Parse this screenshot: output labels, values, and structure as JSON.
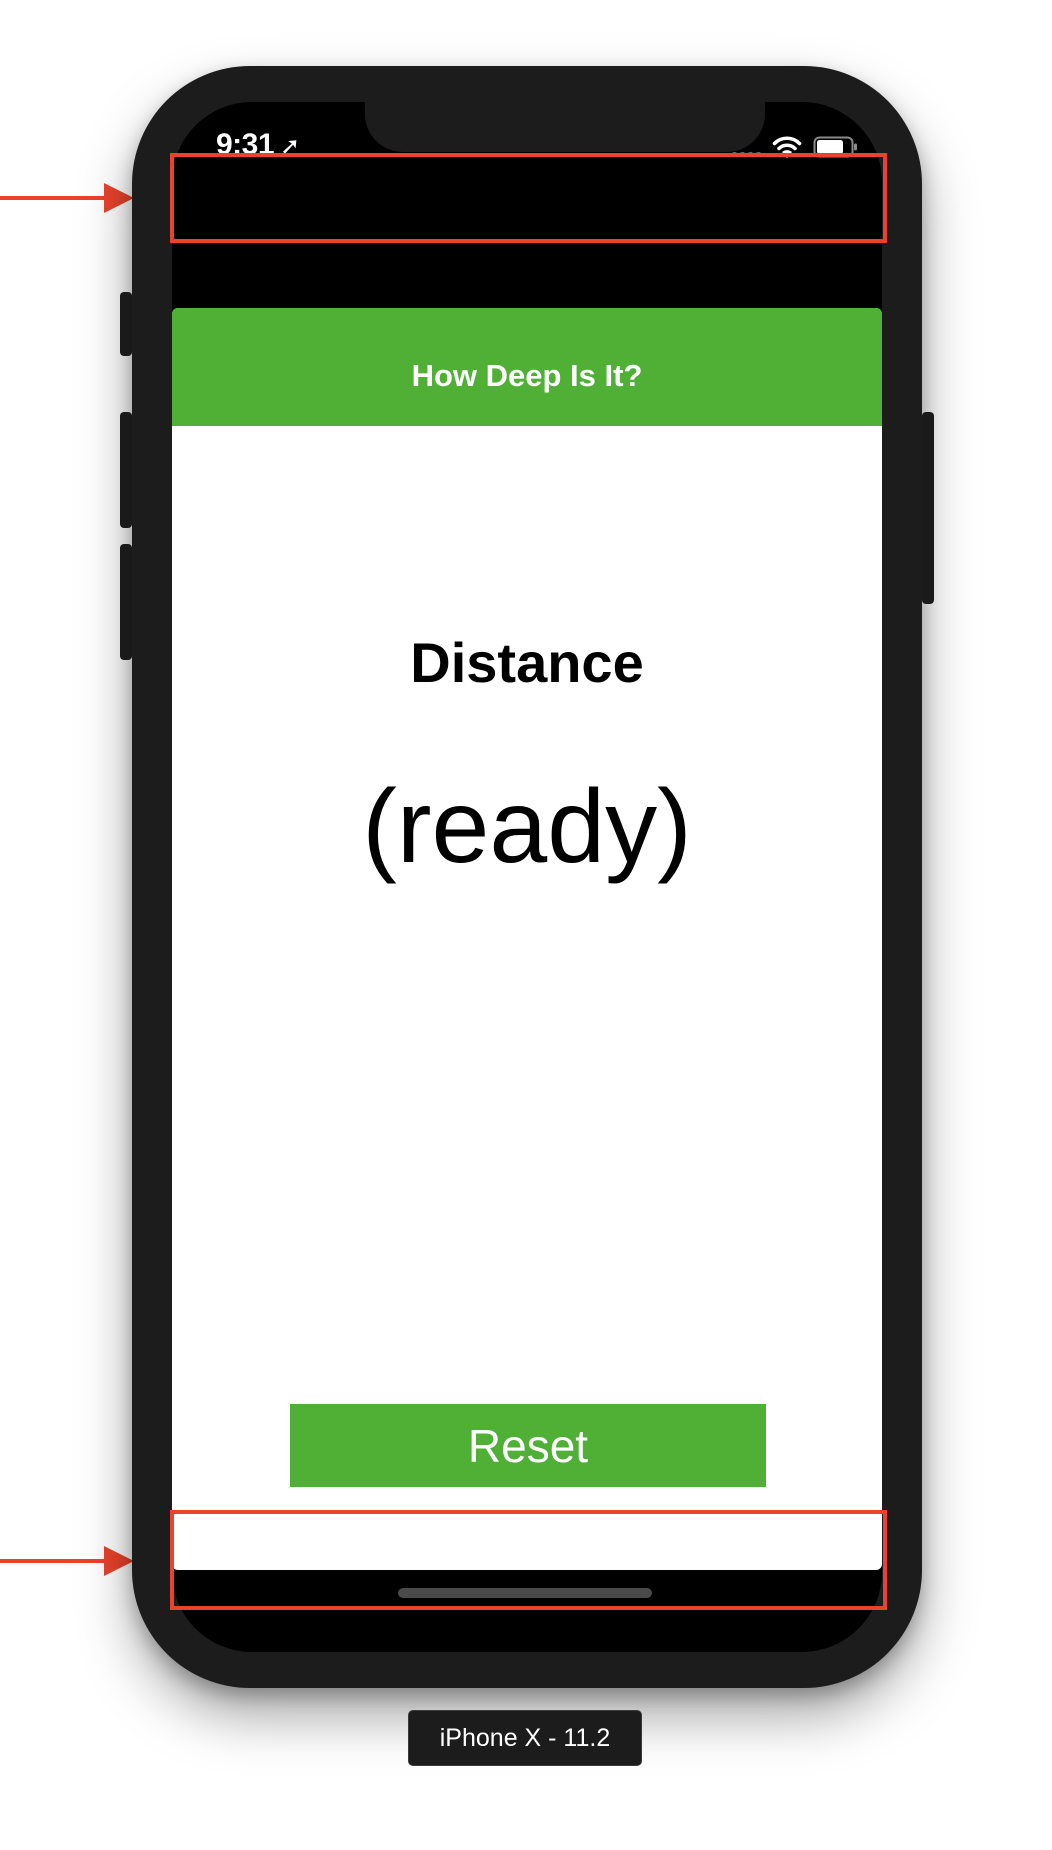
{
  "status_bar": {
    "time": "9:31",
    "location_icon": "location-arrow-icon",
    "wifi_icon": "wifi-icon",
    "battery_icon": "battery-icon"
  },
  "app": {
    "nav_title": "How Deep Is It?",
    "distance_label": "Distance",
    "distance_value": "(ready)",
    "reset_label": "Reset"
  },
  "device": {
    "label": "iPhone X - 11.2"
  },
  "colors": {
    "accent_green": "#4fb035",
    "annotation_red": "#e9432c",
    "device_body": "#1c1c1c"
  }
}
